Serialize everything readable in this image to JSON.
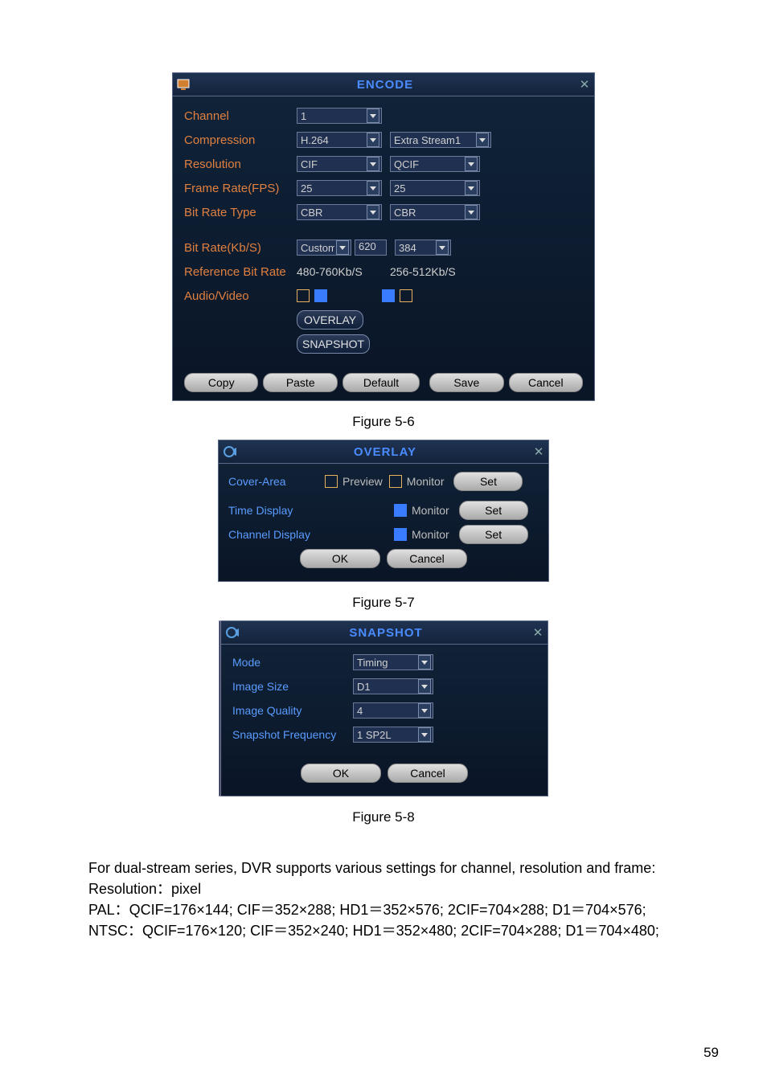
{
  "encode": {
    "title": "ENCODE",
    "channel_lbl": "Channel",
    "channel_val": "1",
    "compression_lbl": "Compression",
    "compression_val": "H.264",
    "extra_stream_val": "Extra Stream1",
    "resolution_lbl": "Resolution",
    "resolution_val": "CIF",
    "resolution2_val": "QCIF",
    "fps_lbl": "Frame Rate(FPS)",
    "fps_val": "25",
    "fps2_val": "25",
    "brt_lbl": "Bit Rate Type",
    "brt_val": "CBR",
    "brt2_val": "CBR",
    "br_lbl": "Bit Rate(Kb/S)",
    "br_mode": "Customi",
    "br_custom_val": "620",
    "br2_val": "384",
    "ref_lbl": "Reference Bit Rate",
    "ref1": "480-760Kb/S",
    "ref2": "256-512Kb/S",
    "av_lbl": "Audio/Video",
    "overlay_btn": "OVERLAY",
    "snapshot_btn": "SNAPSHOT",
    "copy": "Copy",
    "paste": "Paste",
    "default": "Default",
    "save": "Save",
    "cancel": "Cancel"
  },
  "fig1": "Figure 5-6",
  "overlay": {
    "title": "OVERLAY",
    "cover_lbl": "Cover-Area",
    "preview": "Preview",
    "monitor": "Monitor",
    "set": "Set",
    "time_lbl": "Time Display",
    "chan_lbl": "Channel Display",
    "ok": "OK",
    "cancel": "Cancel"
  },
  "fig2": "Figure 5-7",
  "snapshot": {
    "title": "SNAPSHOT",
    "mode_lbl": "Mode",
    "mode_val": "Timing",
    "size_lbl": "Image Size",
    "size_val": "D1",
    "qual_lbl": "Image Quality",
    "qual_val": "4",
    "freq_lbl": "Snapshot Frequency",
    "freq_val": "1 SP2L",
    "ok": "OK",
    "cancel": "Cancel"
  },
  "fig3": "Figure 5-8",
  "text": {
    "p1": "For dual-stream series, DVR supports various settings for channel, resolution and frame:",
    "p2": "Resolution：pixel",
    "p3": "PAL：QCIF=176×144; CIF＝352×288; HD1＝352×576; 2CIF=704×288; D1＝704×576;",
    "p4": "NTSC：QCIF=176×120; CIF＝352×240; HD1＝352×480; 2CIF=704×288; D1＝704×480;"
  },
  "pagenum": "59"
}
